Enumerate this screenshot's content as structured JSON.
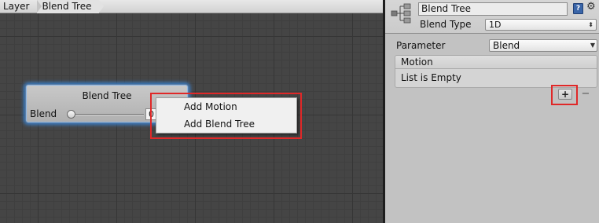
{
  "breadcrumb": {
    "items": [
      "Layer",
      "Blend Tree"
    ]
  },
  "node": {
    "title": "Blend Tree",
    "parameter_label": "Blend",
    "value": "0",
    "slider_fraction": 0
  },
  "context_menu": {
    "items": [
      "Add Motion",
      "Add Blend Tree"
    ]
  },
  "inspector": {
    "name": "Blend Tree",
    "help_icon": "book-help-icon",
    "gear_icon": "gear-icon",
    "blend_type_label": "Blend Type",
    "blend_type_value": "1D",
    "parameter_label": "Parameter",
    "parameter_value": "Blend",
    "motion_list": {
      "header": "Motion",
      "empty_text": "List is Empty"
    },
    "add_button_label": "+",
    "remove_button_label": "−"
  },
  "colors": {
    "highlight": "#e02828",
    "node_glow": "#3b7fc9",
    "graph_bg": "#454545",
    "inspector_bg": "#c2c2c2"
  }
}
